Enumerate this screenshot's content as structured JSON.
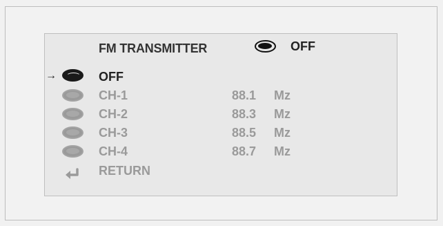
{
  "header": {
    "title": "FM TRANSMITTER",
    "state": "OFF",
    "state_icon": "radio-disc-icon"
  },
  "cursor": "→",
  "menu": [
    {
      "label": "OFF",
      "freq": "",
      "unit": "",
      "selected": true
    },
    {
      "label": "CH-1",
      "freq": "88.1",
      "unit": "Mz",
      "selected": false
    },
    {
      "label": "CH-2",
      "freq": "88.3",
      "unit": "Mz",
      "selected": false
    },
    {
      "label": "CH-3",
      "freq": "88.5",
      "unit": "Mz",
      "selected": false
    },
    {
      "label": "CH-4",
      "freq": "88.7",
      "unit": "Mz",
      "selected": false
    }
  ],
  "return": {
    "label": "RETURN",
    "icon": "return-arrow-icon"
  },
  "colors": {
    "selected": "#222222",
    "unselected": "#9a9a9a",
    "panel": "#e8e8e8"
  }
}
